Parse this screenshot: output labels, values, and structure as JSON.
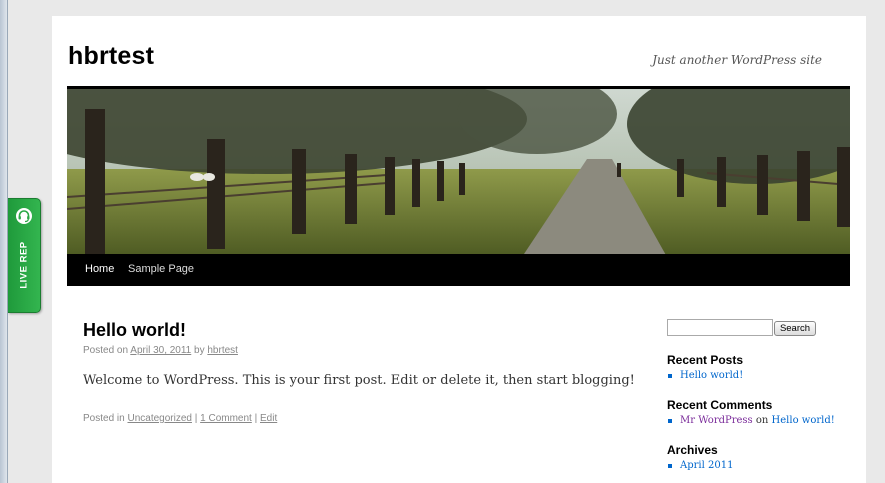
{
  "site": {
    "title": "hbrtest",
    "description": "Just another WordPress site"
  },
  "nav": {
    "items": [
      "Home",
      "Sample Page"
    ]
  },
  "post": {
    "title": "Hello world!",
    "meta_posted_on": "Posted on",
    "date": "April 30, 2011",
    "meta_by": "by",
    "author": "hbrtest",
    "content": "Welcome to WordPress. This is your first post. Edit or delete it, then start blogging!",
    "posted_in": "Posted in",
    "category": "Uncategorized",
    "separator": "|",
    "comments": "1 Comment",
    "edit": "Edit"
  },
  "sidebar": {
    "search_button": "Search",
    "search_value": "",
    "recent_posts_title": "Recent Posts",
    "recent_posts": [
      "Hello world!"
    ],
    "recent_comments_title": "Recent Comments",
    "recent_comment_author": "Mr WordPress",
    "recent_comment_on": "on",
    "recent_comment_post": "Hello world!",
    "archives_title": "Archives",
    "archives": [
      "April 2011"
    ]
  },
  "live_rep": {
    "label": "LIVE REP",
    "icon": "headset-icon",
    "color": "#2aa845"
  },
  "colors": {
    "link": "#0066cc",
    "nav_bg": "#000000"
  }
}
